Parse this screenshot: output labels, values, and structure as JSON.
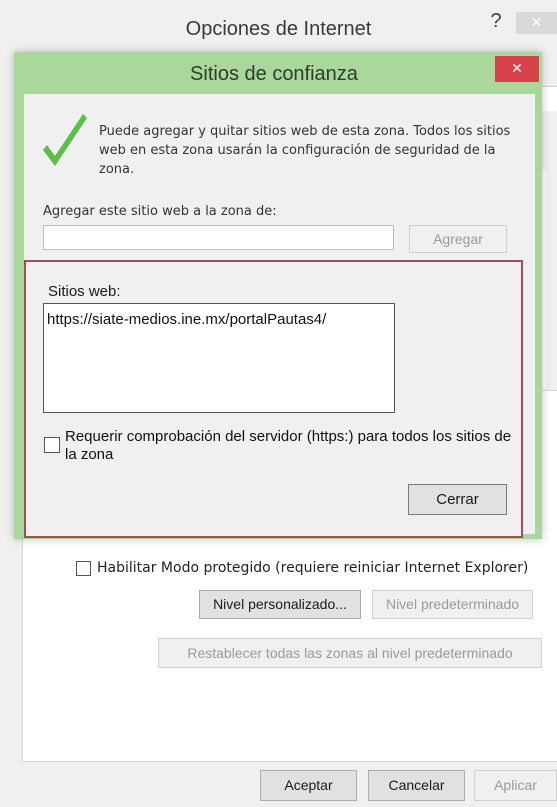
{
  "parent_window": {
    "title": "Opciones de Internet",
    "help_label": "?",
    "close_label": "✕",
    "protected_mode_label": "Habilitar Modo protegido (requiere reiniciar Internet Explorer)",
    "custom_level_label": "Nivel personalizado...",
    "default_level_label": "Nivel predeterminado",
    "reset_all_label": "Restablecer todas las zonas al nivel predeterminado",
    "accept_label": "Aceptar",
    "cancel_label": "Cancelar",
    "apply_label": "Aplicar"
  },
  "dialog": {
    "title": "Sitios de confianza",
    "close_label": "✕",
    "info_text": "Puede agregar y quitar sitios web de esta zona. Todos los sitios web en esta zona usarán la configuración de seguridad de la zona.",
    "add_label": "Agregar este sitio web a la zona de:",
    "add_input_value": "",
    "add_button_label": "Agregar",
    "sites_label": "Sitios web:",
    "sites": [
      "https://siate-medios.ine.mx/portalPautas4/"
    ],
    "require_https_label": "Requerir comprobación del servidor (https:) para todos los sitios de la zona",
    "require_https_checked": false,
    "close_button_label": "Cerrar"
  },
  "colors": {
    "dialog_frame": "#a9d89a",
    "close_button": "#d8424a",
    "highlight_border": "#a9485d",
    "check_mark": "#5cbf4a"
  }
}
